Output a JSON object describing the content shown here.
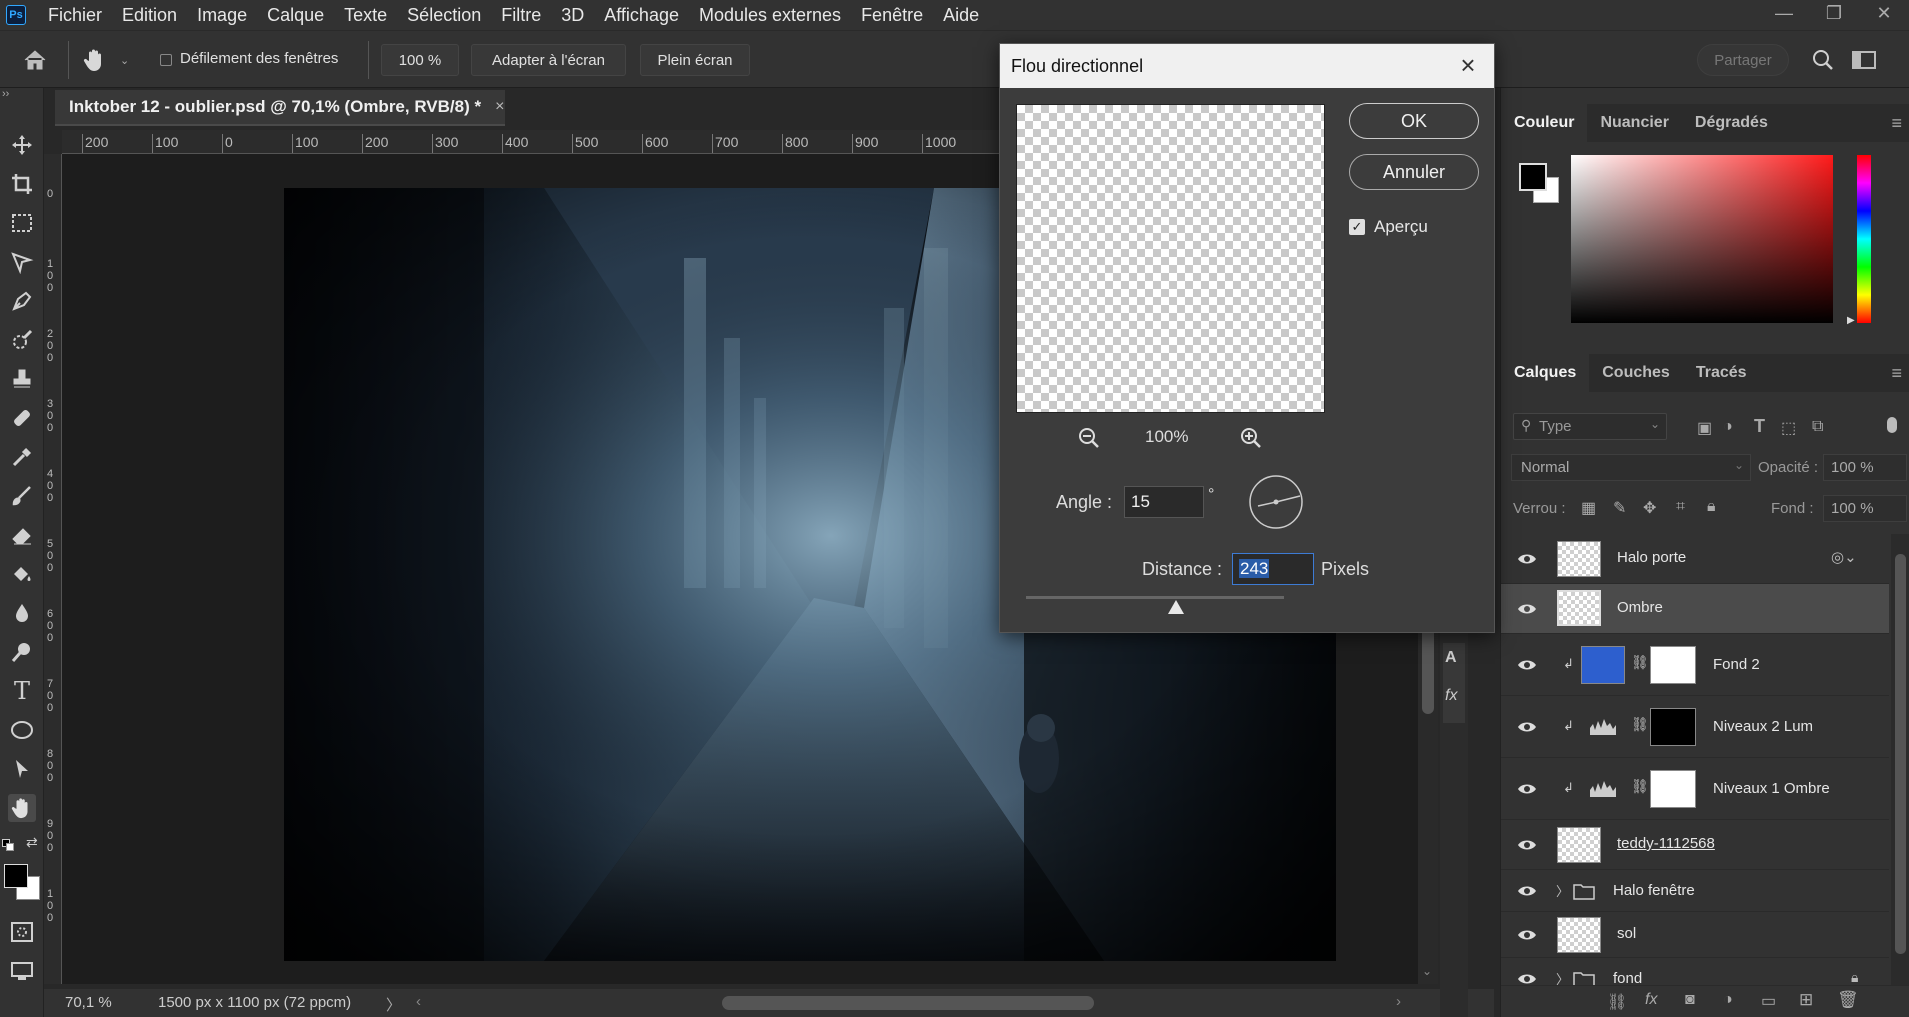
{
  "menubar": {
    "logo": "Ps",
    "items": [
      "Fichier",
      "Edition",
      "Image",
      "Calque",
      "Texte",
      "Sélection",
      "Filtre",
      "3D",
      "Affichage",
      "Modules externes",
      "Fenêtre",
      "Aide"
    ]
  },
  "optionsbar": {
    "scroll_all_label": "Défilement des fenêtres",
    "zoom_btn": "100 %",
    "fit_btn": "Adapter à l'écran",
    "fill_btn": "Plein écran",
    "share_btn": "Partager"
  },
  "document": {
    "tab_title": "Inktober 12 - oublier.psd @ 70,1% (Ombre, RVB/8) *",
    "tab_close": "×",
    "ruler_top": [
      "200",
      "100",
      "0",
      "100",
      "200",
      "300",
      "400",
      "500",
      "600",
      "700",
      "800",
      "900",
      "1000"
    ],
    "ruler_left": [
      "0",
      "1 0 0",
      "2 0 0",
      "3 0 0",
      "4 0 0",
      "5 0 0",
      "6 0 0",
      "7 0 0",
      "8 0 0",
      "9 0 0",
      "1 0 0"
    ]
  },
  "statusbar": {
    "zoom": "70,1 %",
    "dimensions": "1500 px x 1100 px (72 ppcm)",
    "arrow": "〉"
  },
  "dialog": {
    "title": "Flou directionnel",
    "ok": "OK",
    "cancel": "Annuler",
    "preview_label": "Aperçu",
    "preview_checked": true,
    "zoom_level": "100%",
    "angle_label": "Angle :",
    "angle_value": "15",
    "angle_unit": "°",
    "distance_label": "Distance :",
    "distance_value": "243",
    "distance_unit": "Pixels",
    "distance_slider_fraction": 0.58
  },
  "color_panel": {
    "tabs": [
      "Couleur",
      "Nuancier",
      "Dégradés"
    ],
    "foreground": "#000000",
    "background": "#ffffff"
  },
  "layers_panel": {
    "tabs": [
      "Calques",
      "Couches",
      "Tracés"
    ],
    "filter_placeholder": "Type",
    "blend_mode": "Normal",
    "opacity_label": "Opacité :",
    "opacity_value": "100 %",
    "lock_label": "Verrou :",
    "fill_label": "Fond :",
    "fill_value": "100 %",
    "layers": [
      {
        "name": "Halo porte"
      },
      {
        "name": "Ombre"
      },
      {
        "name": "Fond 2"
      },
      {
        "name": "Niveaux 2 Lum"
      },
      {
        "name": "Niveaux 1 Ombre"
      },
      {
        "name": "teddy-1112568"
      },
      {
        "name": "Halo fenêtre"
      },
      {
        "name": "sol"
      },
      {
        "name": "fond"
      }
    ]
  },
  "colors": {
    "accent": "#31a8ff",
    "fond2_swatch": "#2d5fce",
    "selection_highlight": "#2a5ca8"
  }
}
